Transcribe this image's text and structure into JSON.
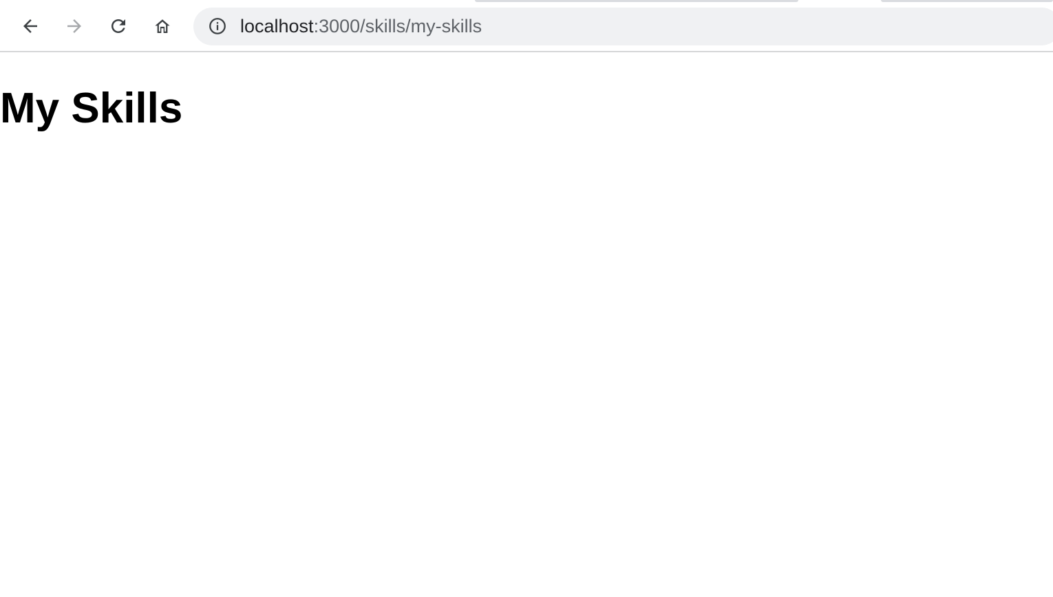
{
  "browser": {
    "nav": {
      "back_icon": "arrow-left-icon",
      "forward_icon": "arrow-right-icon",
      "reload_icon": "reload-icon",
      "home_icon": "home-icon"
    },
    "address_bar": {
      "security_icon": "info-icon",
      "url_host": "localhost",
      "url_path": ":3000/skills/my-skills"
    }
  },
  "page": {
    "title": "My Skills"
  },
  "colors": {
    "icon_active": "#3c4043",
    "icon_disabled": "#a6a8ab",
    "omnibox_bg": "#f0f1f3"
  }
}
